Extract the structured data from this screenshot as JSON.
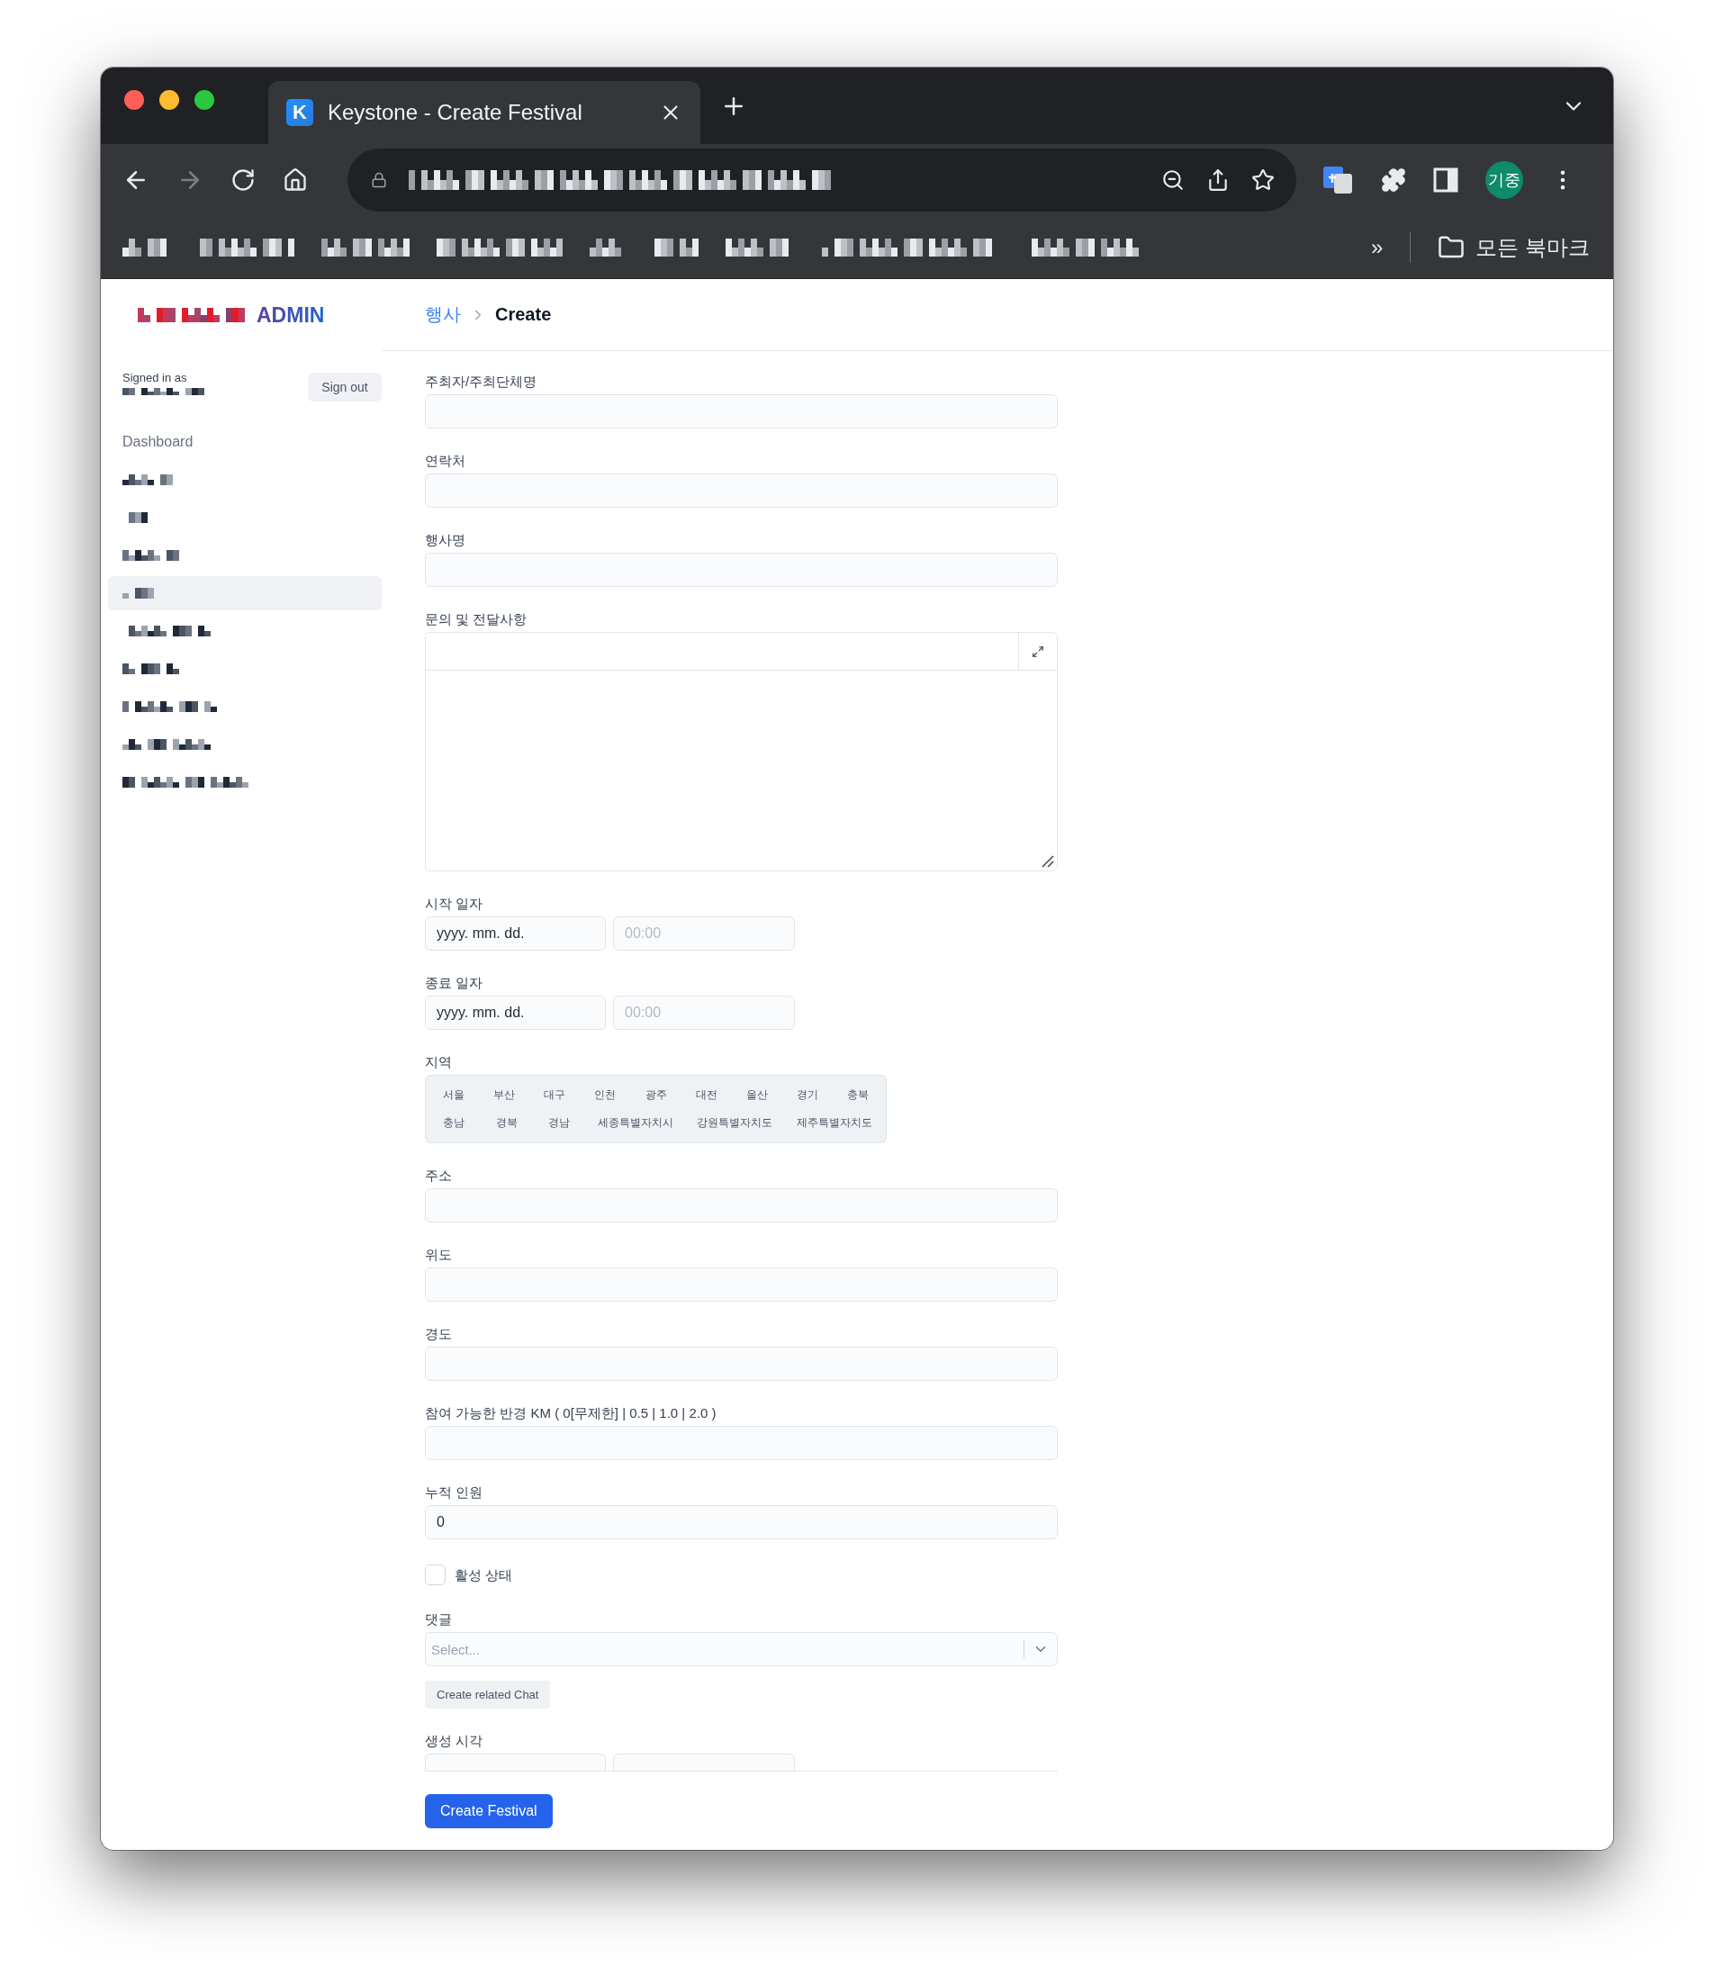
{
  "browser": {
    "tab": {
      "title": "Keystone - Create Festival",
      "favicon": "K"
    },
    "profile": "기중",
    "bookmarks": {
      "overflow": "»",
      "all_bookmarks": "모든 북마크"
    }
  },
  "header": {
    "logo_suffix": "ADMIN",
    "breadcrumb": [
      {
        "label": "행사",
        "kind": "link"
      },
      {
        "label": "Create",
        "kind": "current"
      }
    ]
  },
  "sidebar": {
    "signed_in_label": "Signed in as",
    "sign_out": "Sign out",
    "dashboard": "Dashboard",
    "nav_items": [
      {
        "selected": false
      },
      {
        "selected": false
      },
      {
        "selected": false
      },
      {
        "selected": true
      },
      {
        "selected": false
      },
      {
        "selected": false
      },
      {
        "selected": false
      },
      {
        "selected": false
      },
      {
        "selected": false
      }
    ]
  },
  "form": {
    "fields": [
      {
        "kind": "text",
        "label": "주최자/주최단체명"
      },
      {
        "kind": "text",
        "label": "연락처"
      },
      {
        "kind": "text",
        "label": "행사명"
      },
      {
        "kind": "editor",
        "label": "문의 및 전달사항"
      },
      {
        "kind": "datetime",
        "label": "시작 일자",
        "date_text": "yyyy. mm. dd.",
        "time_placeholder": "00:00"
      },
      {
        "kind": "datetime",
        "label": "종료 일자",
        "date_text": "yyyy. mm. dd.",
        "time_placeholder": "00:00"
      },
      {
        "kind": "segmented",
        "label": "지역",
        "options": [
          {
            "label": "서울",
            "selected": false
          },
          {
            "label": "부산",
            "selected": false
          },
          {
            "label": "대구",
            "selected": false
          },
          {
            "label": "인천",
            "selected": false
          },
          {
            "label": "광주",
            "selected": false
          },
          {
            "label": "대전",
            "selected": false
          },
          {
            "label": "울산",
            "selected": false
          },
          {
            "label": "경기",
            "selected": false
          },
          {
            "label": "충북",
            "selected": false
          },
          {
            "label": "충남",
            "selected": false
          },
          {
            "label": "경북",
            "selected": false
          },
          {
            "label": "경남",
            "selected": false
          },
          {
            "label": "세종특별자치시",
            "selected": false
          },
          {
            "label": "강원특별자치도",
            "selected": false
          },
          {
            "label": "제주특별자치도",
            "selected": false
          }
        ]
      },
      {
        "kind": "text",
        "label": "주소"
      },
      {
        "kind": "text",
        "label": "위도"
      },
      {
        "kind": "text",
        "label": "경도"
      },
      {
        "kind": "text",
        "label": "참여 가능한 반경 KM ( 0[무제한] | 0.5 | 1.0 | 2.0 )"
      },
      {
        "kind": "text",
        "label": "누적 인원",
        "value": "0"
      },
      {
        "kind": "checkbox",
        "label": "활성 상태",
        "checked": false
      },
      {
        "kind": "select",
        "label": "댓글",
        "placeholder": "Select...",
        "action": "Create related Chat"
      },
      {
        "kind": "datetime",
        "label": "생성 시각"
      }
    ],
    "submit": "Create Festival"
  }
}
